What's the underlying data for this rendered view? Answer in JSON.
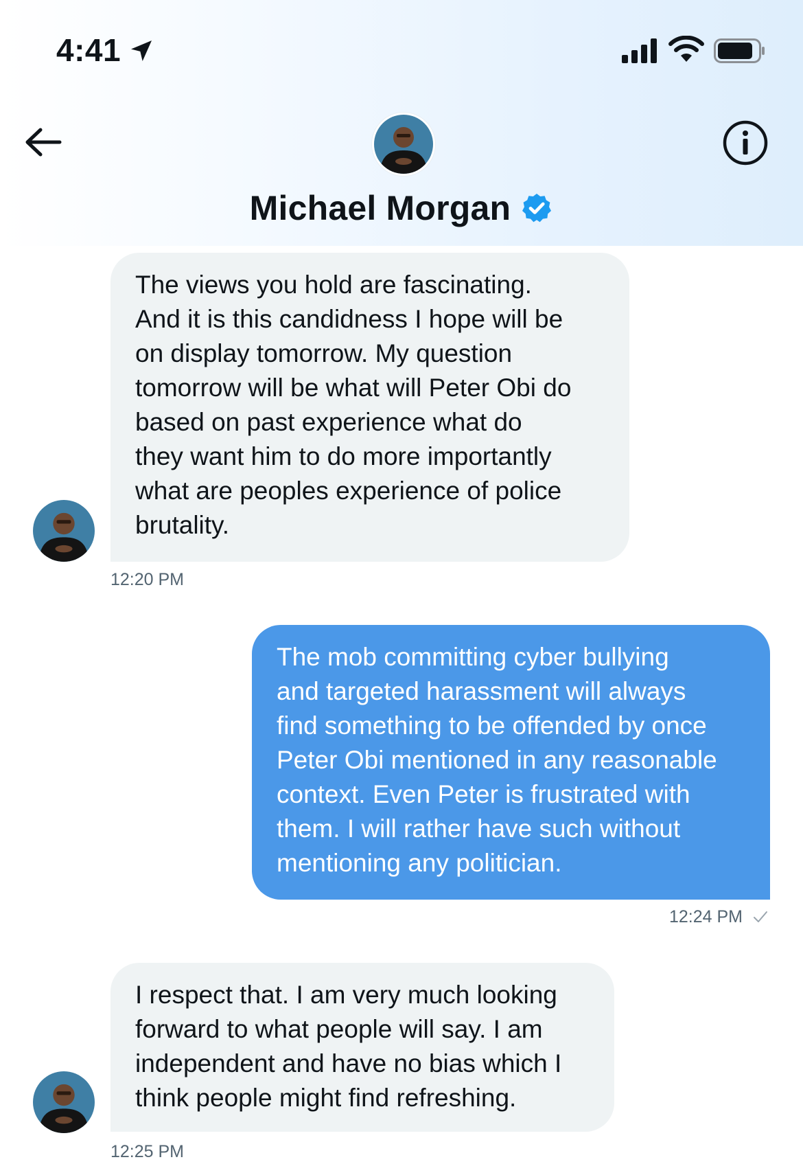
{
  "status_bar": {
    "time": "4:41",
    "icons": [
      "location-arrow-icon",
      "cellular-signal-icon",
      "wifi-icon",
      "battery-icon"
    ]
  },
  "header": {
    "contact_name": "Michael Morgan",
    "verified": true,
    "icons": [
      "back-arrow-icon",
      "info-icon",
      "verified-badge-icon"
    ],
    "accent_color": "#1d9bf0"
  },
  "messages": [
    {
      "direction": "incoming",
      "text": "The views you hold are fascinating.\nAnd it is this candidness I hope will be\non display tomorrow. My question\ntomorrow will be what will Peter Obi do\nbased on past experience what do\nthey want him to do more importantly\nwhat are peoples experience of police\nbrutality.",
      "time": "12:20 PM"
    },
    {
      "direction": "outgoing",
      "text": "The mob committing cyber bullying\nand targeted harassment will always\nfind something to be offended by once\nPeter Obi mentioned in any reasonable\ncontext. Even Peter is frustrated with\nthem. I will rather have such without\nmentioning any politician.",
      "time": "12:24 PM",
      "status_icon": "check-icon"
    },
    {
      "direction": "incoming",
      "text": "I respect that. I am very much looking\nforward to what people will say. I am\nindependent and have no bias which I\nthink people might find refreshing.",
      "time": "12:25 PM"
    }
  ],
  "colors": {
    "incoming_bubble": "#eff3f4",
    "outgoing_bubble": "#4b98e8",
    "timestamp": "#536471"
  }
}
